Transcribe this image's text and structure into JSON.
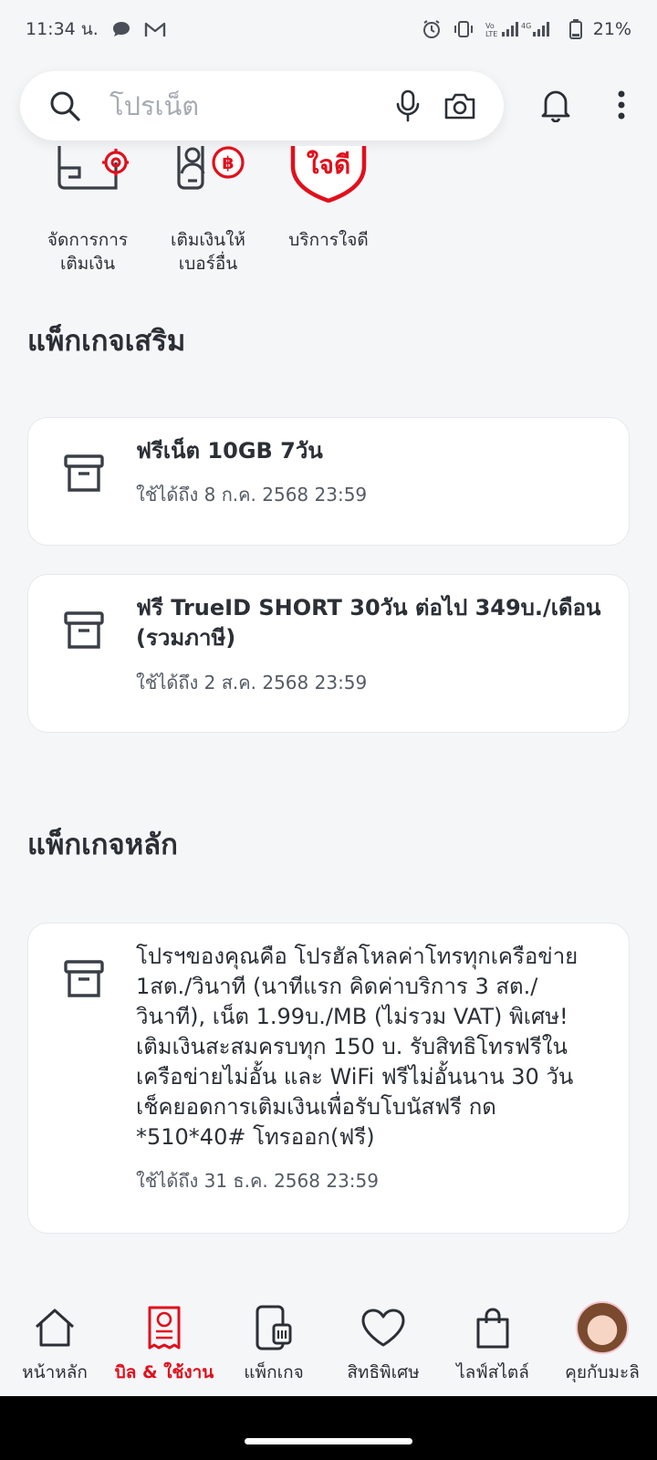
{
  "status": {
    "time": "11:34 น.",
    "battery": "21%"
  },
  "search": {
    "placeholder": "โปรเน็ต"
  },
  "quick_actions": [
    {
      "label": "จัดการการ\nเติมเงิน",
      "icon": "topup-settings-icon"
    },
    {
      "label": "เติมเงินให้\nเบอร์อื่น",
      "icon": "topup-other-icon"
    },
    {
      "label": "บริการใจดี",
      "icon": "jaidee-shield-icon",
      "badge": "ใจดี"
    }
  ],
  "extra_section": {
    "title": "แพ็กเกจเสริม",
    "packages": [
      {
        "title": "ฟรีเน็ต 10GB 7วัน",
        "expiry": "ใช้ได้ถึง 8 ก.ค. 2568 23:59"
      },
      {
        "title": "ฟรี TrueID SHORT 30วัน ต่อไป 349บ./เดือน (รวมภาษี)",
        "expiry": "ใช้ได้ถึง 2 ส.ค. 2568 23:59"
      }
    ]
  },
  "main_section": {
    "title": "แพ็กเกจหลัก",
    "packages": [
      {
        "title": "โปรฯของคุณคือ โปรฮัลโหลค่าโทรทุกเครือข่าย 1สต./วินาที (นาทีแรก คิดค่าบริการ 3 สต./วินาที), เน็ต 1.99บ./MB (ไม่รวม VAT) พิเศษ! เติมเงินสะสมครบทุก 150 บ. รับสิทธิโทรฟรีในเครือข่ายไม่อั้น และ WiFi ฟรีไม่อั้นนาน 30 วัน เช็คยอดการเติมเงินเพื่อรับโบนัสฟรี กด *510*40# โทรออก(ฟรี)",
        "expiry": "ใช้ได้ถึง 31 ธ.ค. 2568 23:59"
      }
    ]
  },
  "nav": {
    "items": [
      {
        "label": "หน้าหลัก",
        "icon": "home-icon",
        "active": false
      },
      {
        "label": "บิล & ใช้งาน",
        "icon": "bill-icon",
        "active": true
      },
      {
        "label": "แพ็กเกจ",
        "icon": "package-phone-icon",
        "active": false
      },
      {
        "label": "สิทธิพิเศษ",
        "icon": "heart-icon",
        "active": false
      },
      {
        "label": "ไลฟ์สไตล์",
        "icon": "shopping-bag-icon",
        "active": false
      },
      {
        "label": "คุยกับมะลิ",
        "icon": "mali-avatar",
        "active": false
      }
    ]
  },
  "colors": {
    "accent": "#e0101c",
    "text": "#2b2f36",
    "background": "#f5f6f8"
  }
}
